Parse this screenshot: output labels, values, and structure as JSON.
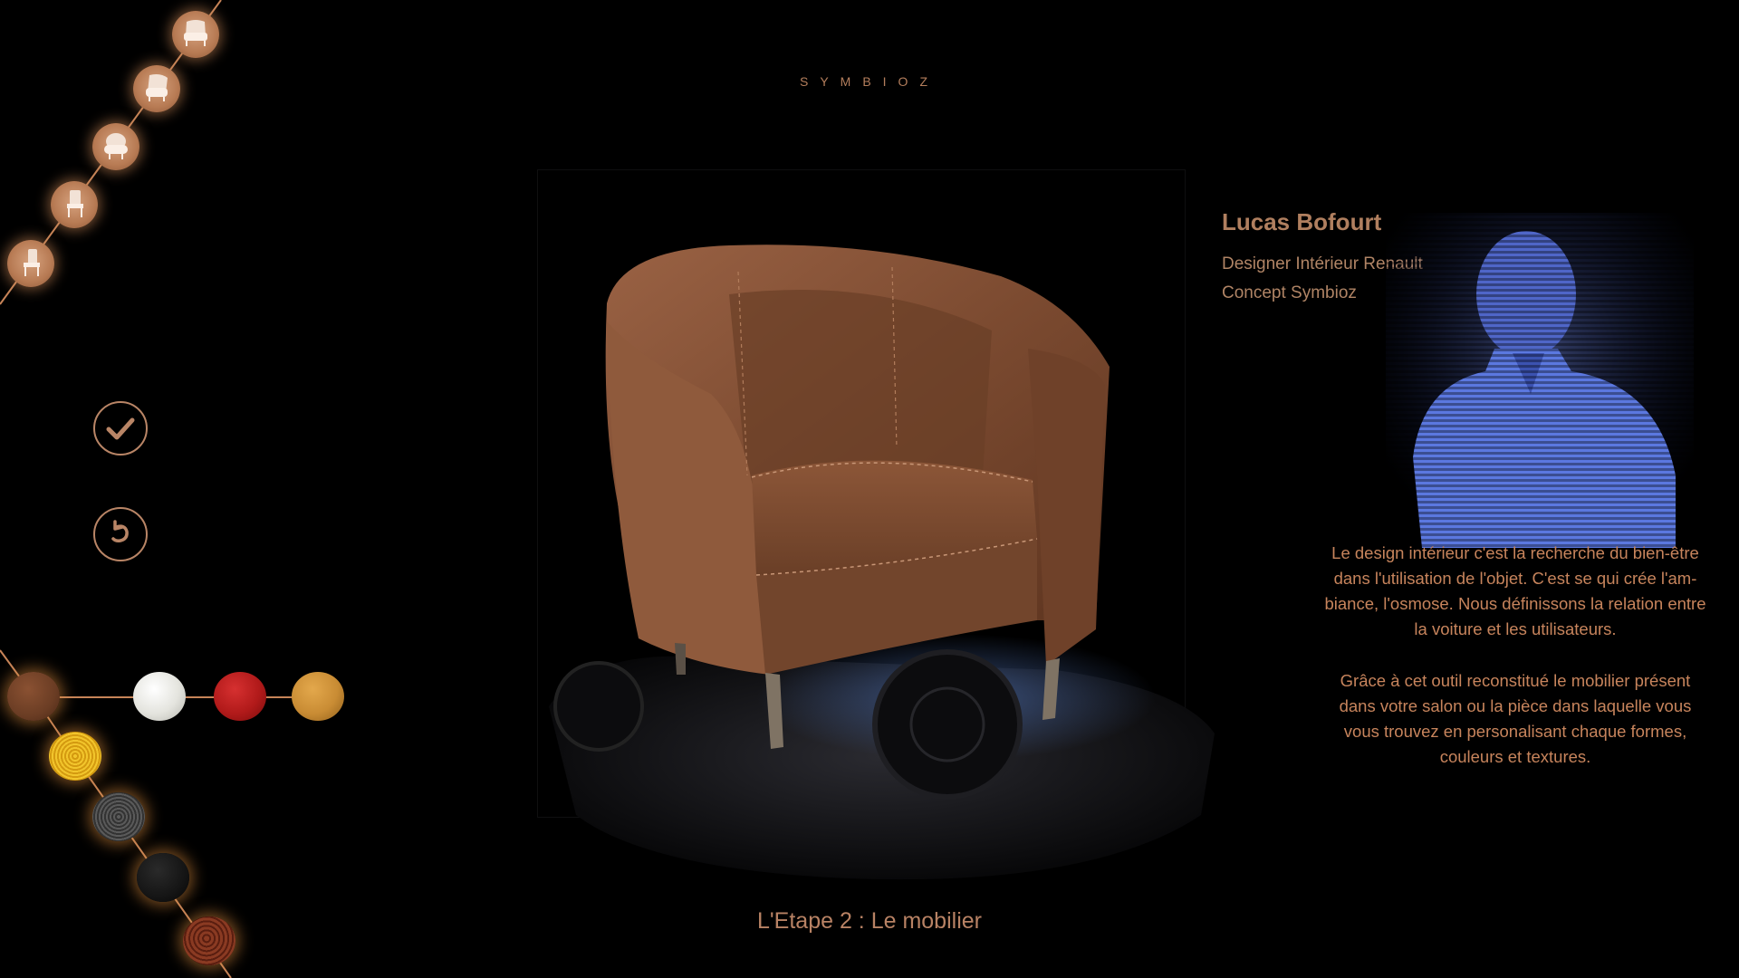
{
  "header": {
    "logo_text": "SYMBIOZ"
  },
  "designer": {
    "name": "Lucas Bofourt",
    "role_line1": "Designer Intérieur Renault",
    "role_line2": "Concept Symbioz"
  },
  "description": {
    "paragraph1": "Le design intérieur c'est la recherche du bien-être dans l'utilisation de l'objet. C'est se qui crée l'am-biance, l'osmose. Nous définissons la relation entre la voiture et les utilisateurs.",
    "paragraph2": "Grâce à cet outil reconstitué le mobilier présent dans votre salon ou la pièce dans laquelle vous vous trouvez en personalisant chaque formes, couleurs et textures."
  },
  "step": {
    "label": "L'Etape 2 : Le mobilier"
  },
  "furniture_models": [
    {
      "icon": "armchair-icon"
    },
    {
      "icon": "armchair-icon"
    },
    {
      "icon": "armchair-icon"
    },
    {
      "icon": "chair-icon"
    },
    {
      "icon": "chair-icon"
    }
  ],
  "actions": {
    "validate_icon": "check-icon",
    "reset_icon": "undo-icon"
  },
  "colors": {
    "accent": "#b98566",
    "swatches": [
      "#6b3d24",
      "#e4e4de",
      "#b11a1a",
      "#c98c34"
    ],
    "textures": [
      "#e9b41d",
      "#4a4a4a",
      "#151515",
      "#6e2a1a"
    ]
  }
}
